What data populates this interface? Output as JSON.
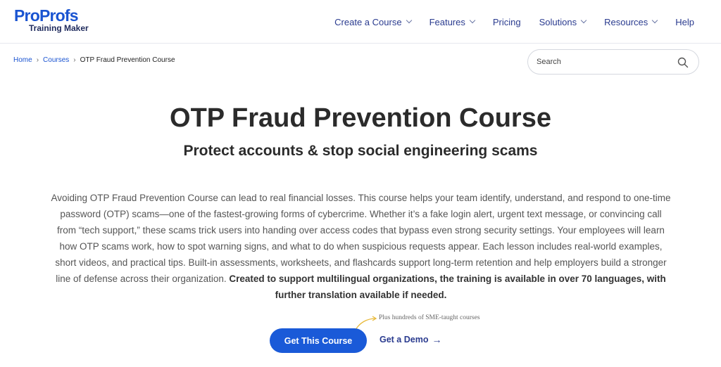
{
  "brand": {
    "name_part1": "Pro",
    "name_part2": "Profs",
    "tagline": "Training Maker"
  },
  "nav": {
    "items": [
      {
        "label": "Create a Course",
        "has_dropdown": true
      },
      {
        "label": "Features",
        "has_dropdown": true
      },
      {
        "label": "Pricing",
        "has_dropdown": false
      },
      {
        "label": "Solutions",
        "has_dropdown": true
      },
      {
        "label": "Resources",
        "has_dropdown": true
      },
      {
        "label": "Help",
        "has_dropdown": false
      }
    ]
  },
  "breadcrumb": {
    "home": "Home",
    "courses": "Courses",
    "current": "OTP Fraud Prevention Course",
    "separator": "›"
  },
  "search": {
    "placeholder": "Search",
    "icon": "search-icon"
  },
  "hero": {
    "title": "OTP Fraud Prevention Course",
    "subtitle": "Protect accounts & stop social engineering scams",
    "description": "Avoiding OTP Fraud Prevention Course can lead to real financial losses. This course helps your team identify, understand, and respond to one-time password (OTP) scams—one of the fastest-growing forms of cybercrime. Whether it’s a fake login alert, urgent text message, or convincing call from “tech support,” these scams trick users into handing over access codes that bypass even strong security settings. Your employees will learn how OTP scams work, how to spot warning signs, and what to do when suspicious requests appear. Each lesson includes real-world examples, short videos, and practical tips. Built-in assessments, worksheets, and flashcards support long-term retention and help employers build a stronger line of defense across their organization.",
    "description_bold": "Created to support multilingual organizations, the training is available in over 70 languages, with further translation available if needed."
  },
  "cta": {
    "note": "Plus hundreds of SME-taught courses",
    "primary_label": "Get This Course",
    "secondary_label": "Get a Demo",
    "secondary_arrow": "→"
  },
  "colors": {
    "brand_blue": "#1a54d1",
    "nav_text": "#2a3b8f",
    "button_bg": "#1a5ad8",
    "note_arrow": "#e8b93a"
  }
}
